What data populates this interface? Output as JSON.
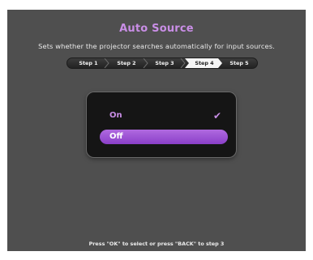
{
  "title": "Auto Source",
  "subtitle": "Sets whether the projector searches automatically for input sources.",
  "steps": [
    {
      "label": "Step 1",
      "active": false
    },
    {
      "label": "Step 2",
      "active": false
    },
    {
      "label": "Step 3",
      "active": false
    },
    {
      "label": "Step 4",
      "active": true
    },
    {
      "label": "Step 5",
      "active": false
    }
  ],
  "options": [
    {
      "label": "On",
      "checked": true,
      "selected": false
    },
    {
      "label": "Off",
      "checked": false,
      "selected": true
    }
  ],
  "footer": "Press \"OK\" to select or press \"BACK\" to step 3",
  "colors": {
    "accent": "#c98ee6",
    "highlight": "#9b50d6",
    "background": "#4f4f4f"
  }
}
